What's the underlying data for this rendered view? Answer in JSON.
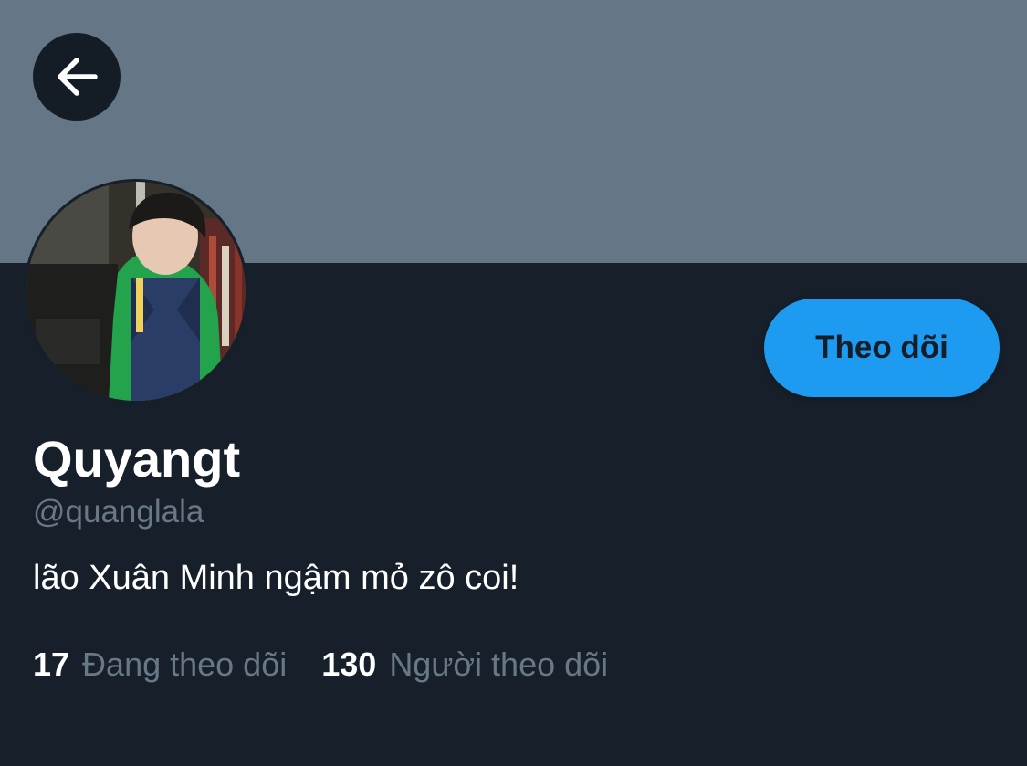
{
  "profile": {
    "display_name": "Quyangt",
    "handle": "@quanglala",
    "bio": "lão Xuân Minh ngậm mỏ zô coi!",
    "follow_button": "Theo dõi"
  },
  "stats": {
    "following_count": "17",
    "following_label": "Đang theo dõi",
    "followers_count": "130",
    "followers_label": "Người theo dõi"
  },
  "icons": {
    "back": "arrow-left-icon"
  },
  "colors": {
    "banner": "#657787",
    "background": "#161f2a",
    "accent": "#1d9bf0",
    "secondary_text": "#687887"
  }
}
